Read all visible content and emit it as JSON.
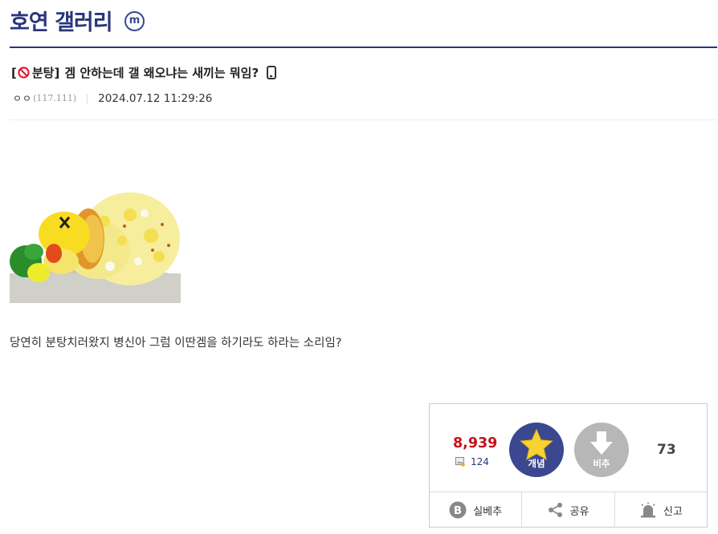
{
  "gallery": {
    "title": "호연 갤러리",
    "badge": "m"
  },
  "post": {
    "head_open": "[",
    "head_label": "분탕]",
    "title": "겜 안하는데 갤 왜오냐는 새끼는 뭐임?",
    "writer": "ㅇㅇ",
    "ip": "(117.111)",
    "date": "2024.07.12 11:29:26",
    "body_text": "당연히 분탕치러왔지 병신아 그럼 이딴겜을 하기라도 하라는 소리임?"
  },
  "icons": {
    "prohibit": "no-entry-icon",
    "mobile": "mobile-phone-icon",
    "fix": "fixed-image-icon",
    "star": "star-icon",
    "down": "down-arrow-icon",
    "best": "best-b-icon",
    "share": "share-icon",
    "report": "siren-icon"
  },
  "colors": {
    "brand": "#29367c",
    "upvote": "#3b4890",
    "downvote": "#b7b7b7",
    "count": "#c7121d",
    "prohibit": "#e0162b"
  },
  "vote": {
    "up_count": "8,939",
    "fix_count": "124",
    "up_label": "개념",
    "down_label": "비추",
    "down_count": "73"
  },
  "actions": {
    "best_label": "실베추",
    "share_label": "공유",
    "report_label": "신고"
  }
}
